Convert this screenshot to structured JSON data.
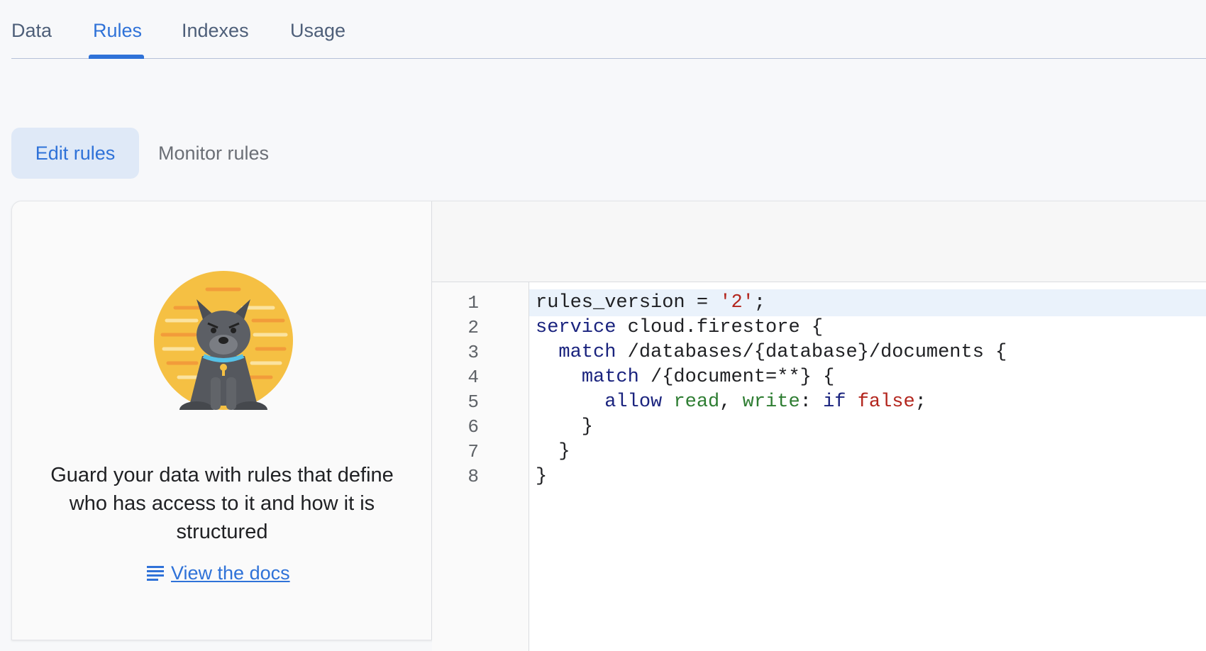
{
  "tabs": {
    "items": [
      {
        "label": "Data"
      },
      {
        "label": "Rules"
      },
      {
        "label": "Indexes"
      },
      {
        "label": "Usage"
      }
    ],
    "active": "Rules"
  },
  "subtabs": {
    "edit_label": "Edit rules",
    "monitor_label": "Monitor rules",
    "active": "Edit rules"
  },
  "info_panel": {
    "illustration_icon": "guard-dog-illustration",
    "text": "Guard your data with rules that define who has access to it and how it is structured",
    "docs_icon": "docs-lines-icon",
    "docs_link": "View the docs"
  },
  "editor": {
    "line_numbers": [
      "1",
      "2",
      "3",
      "4",
      "5",
      "6",
      "7",
      "8"
    ],
    "current_line": 1,
    "lines": [
      [
        {
          "t": "rules_version = ",
          "c": ""
        },
        {
          "t": "'2'",
          "c": "str"
        },
        {
          "t": ";",
          "c": ""
        }
      ],
      [
        {
          "t": "service",
          "c": "kw"
        },
        {
          "t": " cloud.firestore {",
          "c": ""
        }
      ],
      [
        {
          "t": "  ",
          "c": ""
        },
        {
          "t": "match",
          "c": "kw"
        },
        {
          "t": " /databases/{database}/documents {",
          "c": ""
        }
      ],
      [
        {
          "t": "    ",
          "c": ""
        },
        {
          "t": "match",
          "c": "kw"
        },
        {
          "t": " /{document=**} {",
          "c": ""
        }
      ],
      [
        {
          "t": "      ",
          "c": ""
        },
        {
          "t": "allow",
          "c": "kw"
        },
        {
          "t": " ",
          "c": ""
        },
        {
          "t": "read",
          "c": "fn"
        },
        {
          "t": ", ",
          "c": ""
        },
        {
          "t": "write",
          "c": "fn"
        },
        {
          "t": ": ",
          "c": ""
        },
        {
          "t": "if",
          "c": "kw"
        },
        {
          "t": " ",
          "c": ""
        },
        {
          "t": "false",
          "c": "str"
        },
        {
          "t": ";",
          "c": ""
        }
      ],
      [
        {
          "t": "    }",
          "c": ""
        }
      ],
      [
        {
          "t": "  }",
          "c": ""
        }
      ],
      [
        {
          "t": "}",
          "c": ""
        }
      ]
    ]
  },
  "colors": {
    "accent": "#2f72d8",
    "keyword": "#1a237e",
    "string": "#b3261e",
    "permission": "#2e7d32",
    "illustration_bg": "#f5c043"
  }
}
